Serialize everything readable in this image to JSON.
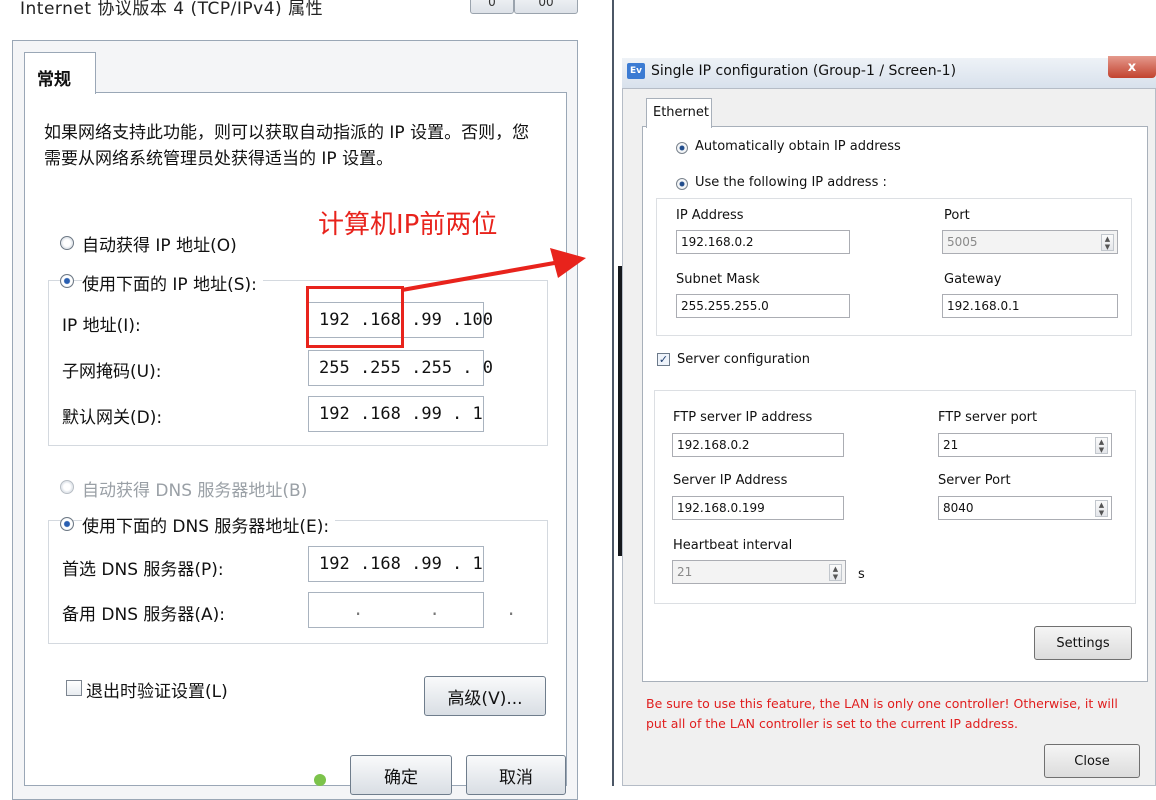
{
  "left_dialog": {
    "title": "Internet 协议版本 4 (TCP/IPv4) 属性",
    "titlebar_buttons": [
      "0",
      "00"
    ],
    "tab_general": "常规",
    "description": "如果网络支持此功能，则可以获取自动指派的 IP 设置。否则，您需要从网络系统管理员处获得适当的 IP 设置。",
    "auto_ip_label": "自动获得 IP 地址(O)",
    "use_ip_label": "使用下面的 IP 地址(S):",
    "ip_label": "IP 地址(I):",
    "ip_value": "192 .168 .99 .100",
    "subnet_label": "子网掩码(U):",
    "subnet_value": "255 .255 .255 . 0",
    "gateway_label": "默认网关(D):",
    "gateway_value": "192 .168 .99 . 1",
    "auto_dns_label": "自动获得 DNS 服务器地址(B)",
    "use_dns_label": "使用下面的 DNS 服务器地址(E):",
    "preferred_dns_label": "首选 DNS 服务器(P):",
    "preferred_dns_value": "192 .168 .99 . 1",
    "alternate_dns_label": "备用 DNS 服务器(A):",
    "alternate_dns_value": ". . .",
    "validate_label": "退出时验证设置(L)",
    "advanced_button": "高级(V)...",
    "ok_button": "确定",
    "cancel_button": "取消"
  },
  "annotation": {
    "text": "计算机IP前两位",
    "color": "#e8231c"
  },
  "right_dialog": {
    "app_icon": "Ev",
    "title": "Single IP configuration   (Group-1 / Screen-1)",
    "close_x": "x",
    "tab_ethernet": "Ethernet",
    "auto_ip_label": "Automatically obtain IP address",
    "use_ip_label": "Use the following IP address :",
    "ip_address_label": "IP Address",
    "ip_address_value": "192.168.0.2",
    "port_label": "Port",
    "port_value": "5005",
    "subnet_label": "Subnet Mask",
    "subnet_value": "255.255.255.0",
    "gateway_label": "Gateway",
    "gateway_value": "192.168.0.1",
    "server_config_label": "Server configuration",
    "ftp_ip_label": "FTP server IP address",
    "ftp_ip_value": "192.168.0.2",
    "ftp_port_label": "FTP server port",
    "ftp_port_value": "21",
    "server_ip_label": "Server IP Address",
    "server_ip_value": "192.168.0.199",
    "server_port_label": "Server Port",
    "server_port_value": "8040",
    "heartbeat_label": "Heartbeat interval",
    "heartbeat_value": "21",
    "heartbeat_unit": "s",
    "settings_button": "Settings",
    "warning": "Be sure to use this feature, the LAN is only one controller! Otherwise, it will put all of the LAN controller is set to the current IP address.",
    "close_button": "Close"
  }
}
